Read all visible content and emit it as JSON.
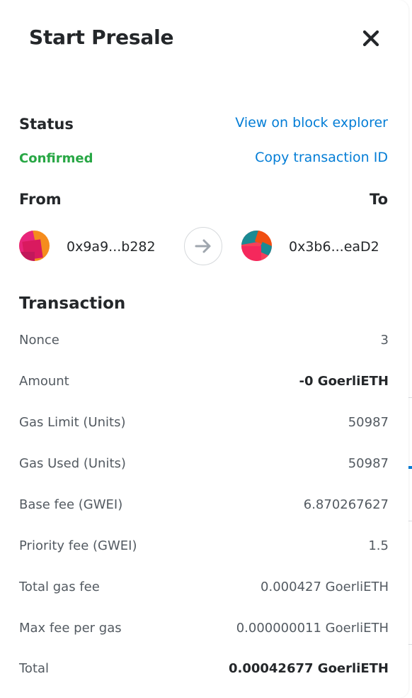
{
  "modal": {
    "title": "Start Presale"
  },
  "status": {
    "label": "Status",
    "value": "Confirmed",
    "view_explorer_link": "View on block explorer",
    "copy_tx_link": "Copy transaction ID"
  },
  "parties": {
    "from_label": "From",
    "to_label": "To",
    "from_address": "0x9a9...b282",
    "to_address": "0x3b6...eaD2"
  },
  "transaction": {
    "title": "Transaction",
    "rows": [
      {
        "label": "Nonce",
        "value": "3"
      },
      {
        "label": "Amount",
        "value": "-0 GoerliETH"
      },
      {
        "label": "Gas Limit (Units)",
        "value": "50987"
      },
      {
        "label": "Gas Used (Units)",
        "value": "50987"
      },
      {
        "label": "Base fee (GWEI)",
        "value": "6.870267627"
      },
      {
        "label": "Priority fee (GWEI)",
        "value": "1.5"
      },
      {
        "label": "Total gas fee",
        "value": "0.000427 GoerliETH"
      },
      {
        "label": "Max fee per gas",
        "value": "0.000000011 GoerliETH"
      },
      {
        "label": "Total",
        "value": "0.00042677 GoerliETH"
      }
    ]
  },
  "icons": {
    "close": "close-icon",
    "arrow": "arrow-right-icon",
    "from_avatar": "jazzicon-avatar",
    "to_avatar": "jazzicon-avatar"
  },
  "colors": {
    "link": "#037dd6",
    "success": "#28a745",
    "text": "#24272a",
    "muted": "#535a61"
  }
}
